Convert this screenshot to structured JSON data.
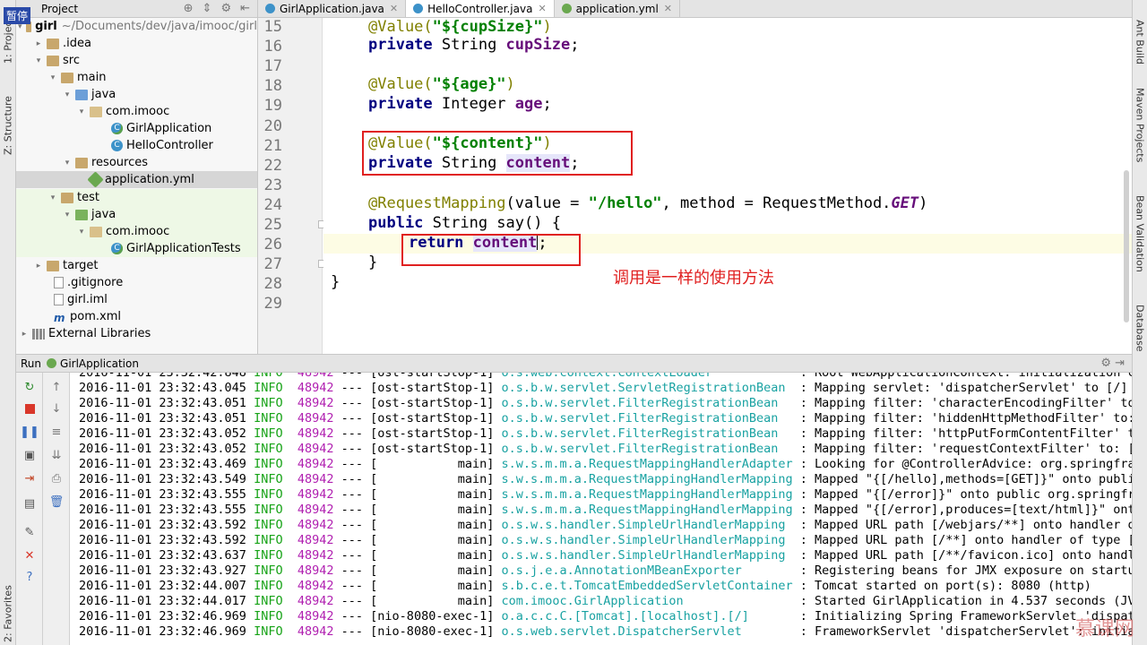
{
  "pause_badge": "暂停",
  "left_strip": {
    "project_tab": "1: Project",
    "structure_tab": "Z: Structure",
    "favorites_tab": "2: Favorites"
  },
  "right_strip": {
    "ant_build": "Ant Build",
    "maven_projects": "Maven Projects",
    "bean_validation": "Bean Validation",
    "database": "Database"
  },
  "project_panel": {
    "title": "Project",
    "tree": [
      {
        "label": "girl",
        "extra": "~/Documents/dev/java/imooc/girl",
        "icon": "folder",
        "arrow": "▾"
      },
      {
        "label": ".idea",
        "icon": "folder",
        "arrow": "▸"
      },
      {
        "label": "src",
        "icon": "folder",
        "arrow": "▾"
      },
      {
        "label": "main",
        "icon": "folder",
        "arrow": "▾"
      },
      {
        "label": "java",
        "icon": "folder-blue",
        "arrow": "▾"
      },
      {
        "label": "com.imooc",
        "icon": "package",
        "arrow": "▾"
      },
      {
        "label": "GirlApplication",
        "icon": "spring-class",
        "arrow": ""
      },
      {
        "label": "HelloController",
        "icon": "class",
        "arrow": ""
      },
      {
        "label": "resources",
        "icon": "folder",
        "arrow": "▾"
      },
      {
        "label": "application.yml",
        "icon": "yml",
        "arrow": ""
      },
      {
        "label": "test",
        "icon": "folder",
        "arrow": "▾"
      },
      {
        "label": "java",
        "icon": "folder-green",
        "arrow": "▾"
      },
      {
        "label": "com.imooc",
        "icon": "package",
        "arrow": "▾"
      },
      {
        "label": "GirlApplicationTests",
        "icon": "spring-class",
        "arrow": ""
      },
      {
        "label": "target",
        "icon": "folder",
        "arrow": "▸"
      },
      {
        "label": ".gitignore",
        "icon": "file",
        "arrow": ""
      },
      {
        "label": "girl.iml",
        "icon": "file",
        "arrow": ""
      },
      {
        "label": "pom.xml",
        "icon": "maven",
        "arrow": ""
      },
      {
        "label": "External Libraries",
        "icon": "library",
        "arrow": "▸"
      }
    ]
  },
  "editor": {
    "tabs": [
      {
        "label": "GirlApplication.java",
        "active": false
      },
      {
        "label": "HelloController.java",
        "active": true
      },
      {
        "label": "application.yml",
        "active": false
      }
    ],
    "line_numbers": [
      "15",
      "16",
      "17",
      "18",
      "19",
      "20",
      "21",
      "22",
      "23",
      "24",
      "25",
      "26",
      "27",
      "28",
      "29"
    ],
    "code": {
      "l15_ann": "@Value(",
      "l15_str": "\"${cupSize}\"",
      "l15_close": ")",
      "l16_kw": "private",
      "l16_type": " String ",
      "l16_field": "cupSize",
      "l16_end": ";",
      "l18_ann": "@Value(",
      "l18_str": "\"${age}\"",
      "l18_close": ")",
      "l19_kw": "private",
      "l19_type": " Integer ",
      "l19_field": "age",
      "l19_end": ";",
      "l21_ann": "@Value(",
      "l21_str": "\"${content}\"",
      "l21_close": ")",
      "l22_kw": "private",
      "l22_type": " String ",
      "l22_field": "content",
      "l22_end": ";",
      "l24_ann": "@RequestMapping",
      "l24_mid1": "(value = ",
      "l24_str": "\"/hello\"",
      "l24_mid2": ", method = RequestMethod.",
      "l24_const": "GET",
      "l24_end": ")",
      "l25_kw": "public",
      "l25_rest": " String say() {",
      "l26_kw": "return",
      "l26_field": "content",
      "l26_end": ";",
      "l27": "}",
      "l28": "}"
    },
    "note": "调用是一样的使用方法"
  },
  "run_panel": {
    "label": "Run",
    "app": "GirlApplication",
    "log": [
      {
        "ts": "2016-11-01 23:32:42.848",
        "lvl": "INFO",
        "pid": "48942",
        "sep": "---",
        "thread": "[ost-startStop-1]",
        "logger": "o.s.web.context.ContextLoader",
        "msg": ": Root WebApplicationContext: initialization co"
      },
      {
        "ts": "2016-11-01 23:32:43.045",
        "lvl": "INFO",
        "pid": "48942",
        "sep": "---",
        "thread": "[ost-startStop-1]",
        "logger": "o.s.b.w.servlet.ServletRegistrationBean",
        "msg": ": Mapping servlet: 'dispatcherServlet' to [/]"
      },
      {
        "ts": "2016-11-01 23:32:43.051",
        "lvl": "INFO",
        "pid": "48942",
        "sep": "---",
        "thread": "[ost-startStop-1]",
        "logger": "o.s.b.w.servlet.FilterRegistrationBean",
        "msg": ": Mapping filter: 'characterEncodingFilter' to:"
      },
      {
        "ts": "2016-11-01 23:32:43.051",
        "lvl": "INFO",
        "pid": "48942",
        "sep": "---",
        "thread": "[ost-startStop-1]",
        "logger": "o.s.b.w.servlet.FilterRegistrationBean",
        "msg": ": Mapping filter: 'hiddenHttpMethodFilter' to:"
      },
      {
        "ts": "2016-11-01 23:32:43.052",
        "lvl": "INFO",
        "pid": "48942",
        "sep": "---",
        "thread": "[ost-startStop-1]",
        "logger": "o.s.b.w.servlet.FilterRegistrationBean",
        "msg": ": Mapping filter: 'httpPutFormContentFilter' to"
      },
      {
        "ts": "2016-11-01 23:32:43.052",
        "lvl": "INFO",
        "pid": "48942",
        "sep": "---",
        "thread": "[ost-startStop-1]",
        "logger": "o.s.b.w.servlet.FilterRegistrationBean",
        "msg": ": Mapping filter: 'requestContextFilter' to: [/"
      },
      {
        "ts": "2016-11-01 23:32:43.469",
        "lvl": "INFO",
        "pid": "48942",
        "sep": "---",
        "thread": "[           main]",
        "logger": "s.w.s.m.m.a.RequestMappingHandlerAdapter",
        "msg": ": Looking for @ControllerAdvice: org.springfram"
      },
      {
        "ts": "2016-11-01 23:32:43.549",
        "lvl": "INFO",
        "pid": "48942",
        "sep": "---",
        "thread": "[           main]",
        "logger": "s.w.s.m.m.a.RequestMappingHandlerMapping",
        "msg": ": Mapped \"{[/hello],methods=[GET]}\" onto public"
      },
      {
        "ts": "2016-11-01 23:32:43.555",
        "lvl": "INFO",
        "pid": "48942",
        "sep": "---",
        "thread": "[           main]",
        "logger": "s.w.s.m.m.a.RequestMappingHandlerMapping",
        "msg": ": Mapped \"{[/error]}\" onto public org.springfra"
      },
      {
        "ts": "2016-11-01 23:32:43.555",
        "lvl": "INFO",
        "pid": "48942",
        "sep": "---",
        "thread": "[           main]",
        "logger": "s.w.s.m.m.a.RequestMappingHandlerMapping",
        "msg": ": Mapped \"{[/error],produces=[text/html]}\" onto"
      },
      {
        "ts": "2016-11-01 23:32:43.592",
        "lvl": "INFO",
        "pid": "48942",
        "sep": "---",
        "thread": "[           main]",
        "logger": "o.s.w.s.handler.SimpleUrlHandlerMapping",
        "msg": ": Mapped URL path [/webjars/**] onto handler of"
      },
      {
        "ts": "2016-11-01 23:32:43.592",
        "lvl": "INFO",
        "pid": "48942",
        "sep": "---",
        "thread": "[           main]",
        "logger": "o.s.w.s.handler.SimpleUrlHandlerMapping",
        "msg": ": Mapped URL path [/**] onto handler of type [c"
      },
      {
        "ts": "2016-11-01 23:32:43.637",
        "lvl": "INFO",
        "pid": "48942",
        "sep": "---",
        "thread": "[           main]",
        "logger": "o.s.w.s.handler.SimpleUrlHandlerMapping",
        "msg": ": Mapped URL path [/**/favicon.ico] onto handle"
      },
      {
        "ts": "2016-11-01 23:32:43.927",
        "lvl": "INFO",
        "pid": "48942",
        "sep": "---",
        "thread": "[           main]",
        "logger": "o.s.j.e.a.AnnotationMBeanExporter",
        "msg": ": Registering beans for JMX exposure on startup"
      },
      {
        "ts": "2016-11-01 23:32:44.007",
        "lvl": "INFO",
        "pid": "48942",
        "sep": "---",
        "thread": "[           main]",
        "logger": "s.b.c.e.t.TomcatEmbeddedServletContainer",
        "msg": ": Tomcat started on port(s): 8080 (http)"
      },
      {
        "ts": "2016-11-01 23:32:44.017",
        "lvl": "INFO",
        "pid": "48942",
        "sep": "---",
        "thread": "[           main]",
        "logger": "com.imooc.GirlApplication",
        "msg": ": Started GirlApplication in 4.537 seconds (JVM"
      },
      {
        "ts": "2016-11-01 23:32:46.969",
        "lvl": "INFO",
        "pid": "48942",
        "sep": "---",
        "thread": "[nio-8080-exec-1]",
        "logger": "o.a.c.c.C.[Tomcat].[localhost].[/]",
        "msg": ": Initializing Spring FrameworkServlet 'dispatc"
      },
      {
        "ts": "2016-11-01 23:32:46.969",
        "lvl": "INFO",
        "pid": "48942",
        "sep": "---",
        "thread": "[nio-8080-exec-1]",
        "logger": "o.s.web.servlet.DispatcherServlet",
        "msg": ": FrameworkServlet 'dispatcherServlet': initial"
      }
    ]
  },
  "watermark": "慕课网"
}
